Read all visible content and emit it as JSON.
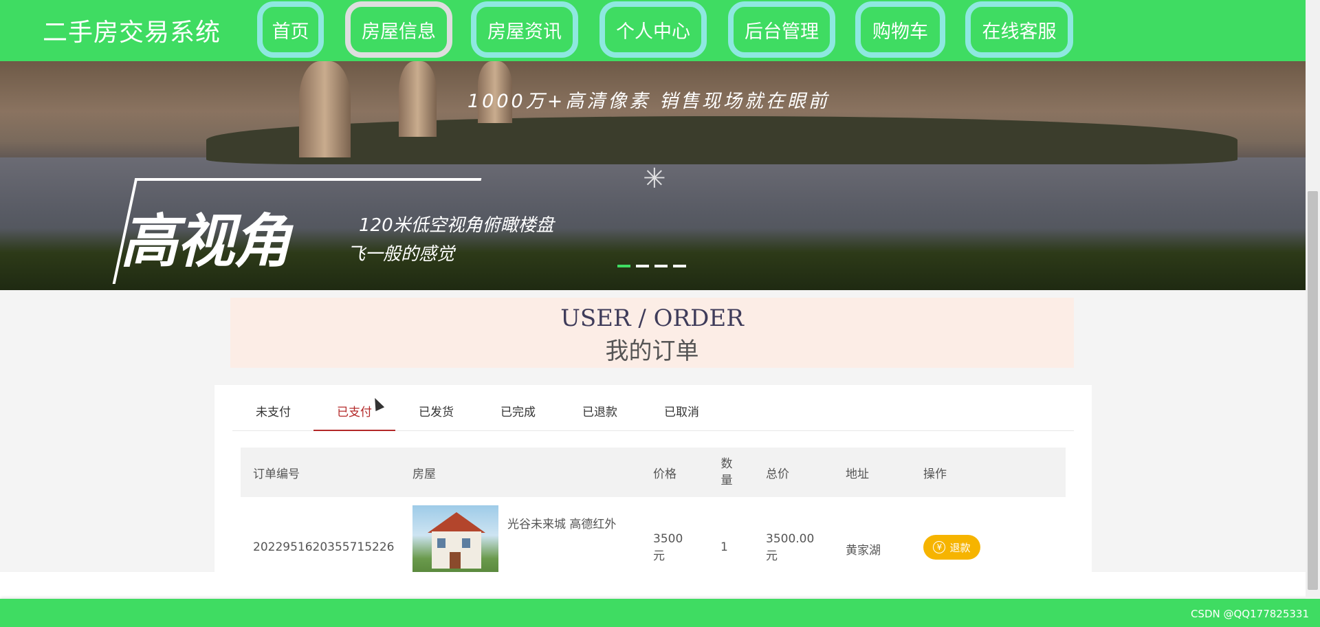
{
  "site": {
    "title": "二手房交易系统"
  },
  "nav": {
    "items": [
      {
        "label": "首页"
      },
      {
        "label": "房屋信息"
      },
      {
        "label": "房屋资讯"
      },
      {
        "label": "个人中心"
      },
      {
        "label": "后台管理"
      },
      {
        "label": "购物车"
      },
      {
        "label": "在线客服"
      }
    ],
    "active_index": 1
  },
  "banner": {
    "tagline": "1000万+高清像素 销售现场就在眼前",
    "headline": "高视角",
    "sub1": "120米低空视角俯瞰楼盘",
    "sub2": "飞一般的感觉",
    "slide_count": 4,
    "active_slide": 0
  },
  "section": {
    "title_en": "USER / ORDER",
    "title_cn": "我的订单"
  },
  "tabs": [
    {
      "label": "未支付"
    },
    {
      "label": "已支付"
    },
    {
      "label": "已发货"
    },
    {
      "label": "已完成"
    },
    {
      "label": "已退款"
    },
    {
      "label": "已取消"
    }
  ],
  "active_tab": "已支付",
  "table": {
    "headers": [
      "订单编号",
      "房屋",
      "价格",
      "数量",
      "总价",
      "地址",
      "操作"
    ],
    "rows": [
      {
        "order_no": "2022951620355715226",
        "house_name": "光谷未来城 高德红外",
        "price": "3500元",
        "quantity": "1",
        "total": "3500.00元",
        "address": "黄家湖",
        "action_label": "退款",
        "action_icon": "yen-icon"
      }
    ]
  },
  "footer": {
    "watermark": "CSDN @QQ177825331"
  },
  "colors": {
    "brand_green": "#3fdc62",
    "nav_ring": "#8ee8e0",
    "active_tab": "#b32828",
    "refund_button": "#f6b400"
  }
}
